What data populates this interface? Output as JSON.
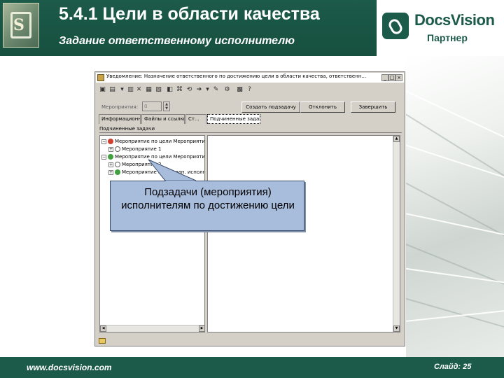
{
  "header": {
    "title": "5.4.1 Цели в области качества",
    "subtitle": "Задание ответственному исполнителю",
    "logo_letter": "S"
  },
  "brand": {
    "name": "DocsVision",
    "partner": "Партнер"
  },
  "window": {
    "title": "Уведомление: Назначение ответственного по достижению цели в области качества, ответственн...",
    "controls": [
      "_",
      "□",
      "×"
    ],
    "field_label": "Мероприятия:",
    "field_value": "0",
    "buttons": {
      "add_subtask": "Создать подзадачу",
      "reject": "Отклонить",
      "finish": "Завершить"
    },
    "tabs": [
      "Информационно",
      "Файлы и ссылки",
      "Ст...",
      "Подчиненные задачи"
    ],
    "subtasks_label": "Подчиненные задачи",
    "tree": [
      {
        "expander": "−",
        "label": "Мероприятие по цели Мероприятие"
      },
      {
        "expander": "+",
        "label": "Мероприятие 1"
      },
      {
        "expander": "−",
        "label": "Мероприятие по цели Мероприятие"
      },
      {
        "expander": "+",
        "label": "Мероприятие 2"
      },
      {
        "expander": "+",
        "label": "Мероприятие по исполн. исполн..."
      }
    ]
  },
  "callout": {
    "text": "Подзадачи (мероприятия) исполнителям по достижению цели"
  },
  "footer": {
    "url": "www.docsvision.com",
    "slide": "Слайд: 25"
  }
}
